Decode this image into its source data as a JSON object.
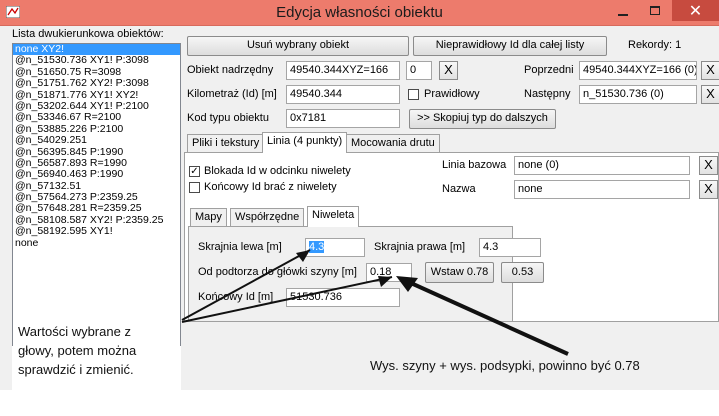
{
  "window": {
    "title": "Edycja własności obiektu",
    "close_glyph": "✕"
  },
  "list": {
    "header": "Lista dwukierunkowa obiektów:",
    "items": [
      "none XY2!",
      "@n_51530.736 XY1! P:3098",
      "@n_51650.75 R=3098",
      "@n_51751.762 XY2! P:3098",
      "@n_51871.776 XY1! XY2!",
      "@n_53202.644 XY1! P:2100",
      "@n_53346.67 R=2100",
      "@n_53885.226 P:2100",
      "@n_54029.251",
      "@n_56395.845 P:1990",
      "@n_56587.893 R=1990",
      "@n_56940.463 P:1990",
      "@n_57132.51",
      "@n_57564.273 P:2359.25",
      "@n_57648.281 R=2359.25",
      "@n_58108.587 XY2! P:2359.25",
      "@n_58192.595 XY1!",
      "none"
    ],
    "selected_index": 0
  },
  "top": {
    "delete_button": "Usuń wybrany obiekt",
    "invalid_id_button": "Nieprawidłowy Id dla całej listy",
    "records": "Rekordy: 1"
  },
  "form": {
    "parent_label": "Obiekt nadrzędny",
    "parent_value": "49540.344XYZ=166",
    "parent_index": "0",
    "km_label": "Kilometraż (Id) [m]",
    "km_value": "49540.344",
    "type_label": "Kod typu obiektu",
    "type_value": "0x7181",
    "copy_button": ">> Skopiuj typ do dalszych",
    "correct_label": "Prawidłowy",
    "prev_label": "Poprzedni",
    "prev_value": "49540.344XYZ=166 (0)",
    "next_label": "Następny",
    "next_value": "n_51530.736 (0)",
    "x_glyph": "X"
  },
  "tabs": [
    "Pliki i tekstury",
    "Linia (4 punkty)",
    "Mocowania drutu"
  ],
  "line": {
    "lock_label": "Blokada Id w odcinku niwelety",
    "lock_checked": true,
    "end_label": "Końcowy Id brać z niwelety",
    "end_checked": false,
    "base_label": "Linia bazowa",
    "base_value": "none (0)",
    "name_label": "Nazwa",
    "name_value": "none"
  },
  "subtabs": [
    "Mapy",
    "Współrzędne",
    "Niweleta"
  ],
  "niweleta": {
    "left_label": "Skrajnia lewa [m]",
    "left_value": "4.3",
    "right_label": "Skrajnia prawa [m]",
    "right_value": "4.3",
    "height_label": "Od podtorza do główki szyny [m]",
    "height_value": "0.18",
    "insert_button": "Wstaw 0.78",
    "alt_button": "0.53",
    "end_label": "Końcowy Id [m]",
    "end_value": "51530.736"
  },
  "annotations": {
    "left_note": [
      "Wartości wybrane z",
      "głowy, potem można",
      "sprawdzić i zmienić."
    ],
    "right_note": "Wys. szyny + wys. podsypki, powinno być 0.78"
  }
}
